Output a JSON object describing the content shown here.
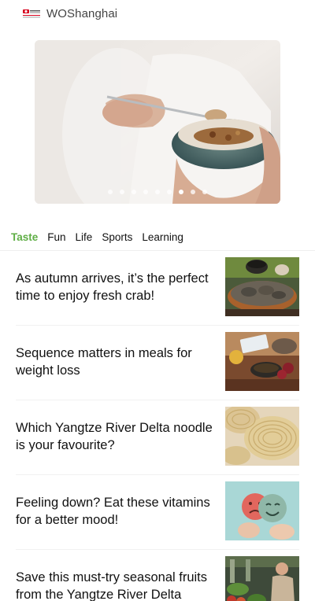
{
  "header": {
    "brand": "WOShanghai",
    "logo_icon": "china-unicom-logo-icon"
  },
  "hero": {
    "image": "bowl-of-granola-photo",
    "slide_count": 9,
    "active_slide": 6
  },
  "tabs": [
    {
      "label": "Taste",
      "active": true
    },
    {
      "label": "Fun",
      "active": false
    },
    {
      "label": "Life",
      "active": false
    },
    {
      "label": "Sports",
      "active": false
    },
    {
      "label": "Learning",
      "active": false
    }
  ],
  "articles": [
    {
      "title": "As autumn arrives, it’s the perfect time to enjoy fresh crab!",
      "thumb": "crab-dinner-photo"
    },
    {
      "title": "Sequence matters in meals for weight loss",
      "thumb": "meal-table-photo"
    },
    {
      "title": "Which Yangtze River Delta noodle is your favourite?",
      "thumb": "noodles-photo"
    },
    {
      "title": "Feeling down? Eat these vitamins for a better mood!",
      "thumb": "mood-faces-photo"
    },
    {
      "title": "Save this must-try seasonal fruits from the Yangtze River Delta",
      "thumb": "fruit-market-photo"
    }
  ],
  "colors": {
    "accent": "#5fae45",
    "brand_text": "#444444"
  }
}
